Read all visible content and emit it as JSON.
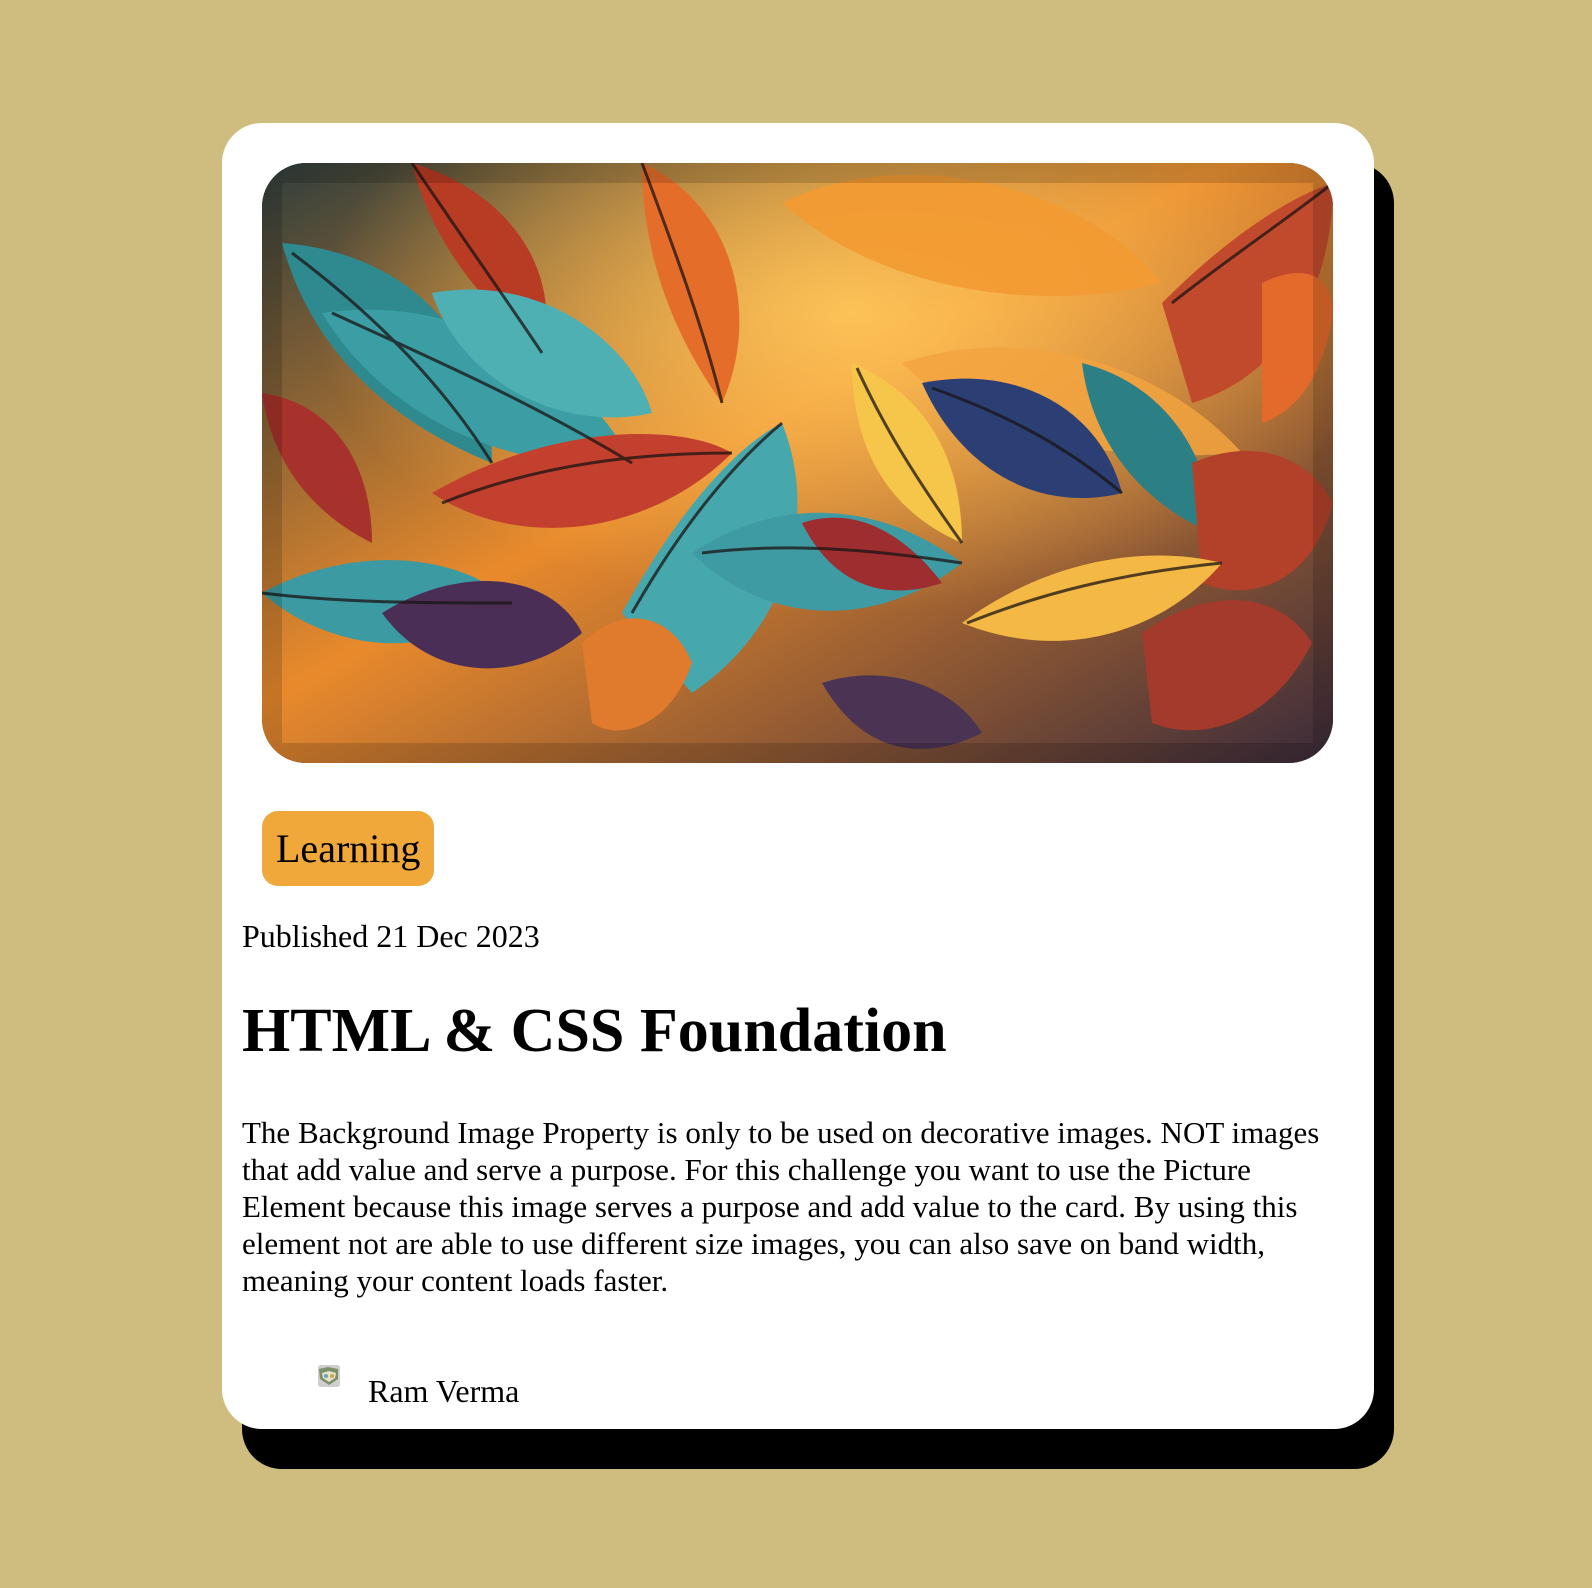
{
  "card": {
    "image_alt": "Autumn leaves illustration",
    "tag": "Learning",
    "published": "Published 21 Dec 2023",
    "title": "HTML & CSS Foundation",
    "description": "The Background Image Property is only to be used on decorative images. NOT images that add value and serve a purpose. For this challenge you want to use the Picture Element because this image serves a purpose and add value to the card. By using this element not are able to use different size images, you can also save on band width, meaning your content loads faster.",
    "author": {
      "name": "Ram Verma",
      "avatar_icon": "avatar-icon"
    }
  },
  "colors": {
    "page_background": "#cfbd7f",
    "card_background": "#ffffff",
    "card_shadow": "#000000",
    "tag_background": "#f0a83a"
  }
}
